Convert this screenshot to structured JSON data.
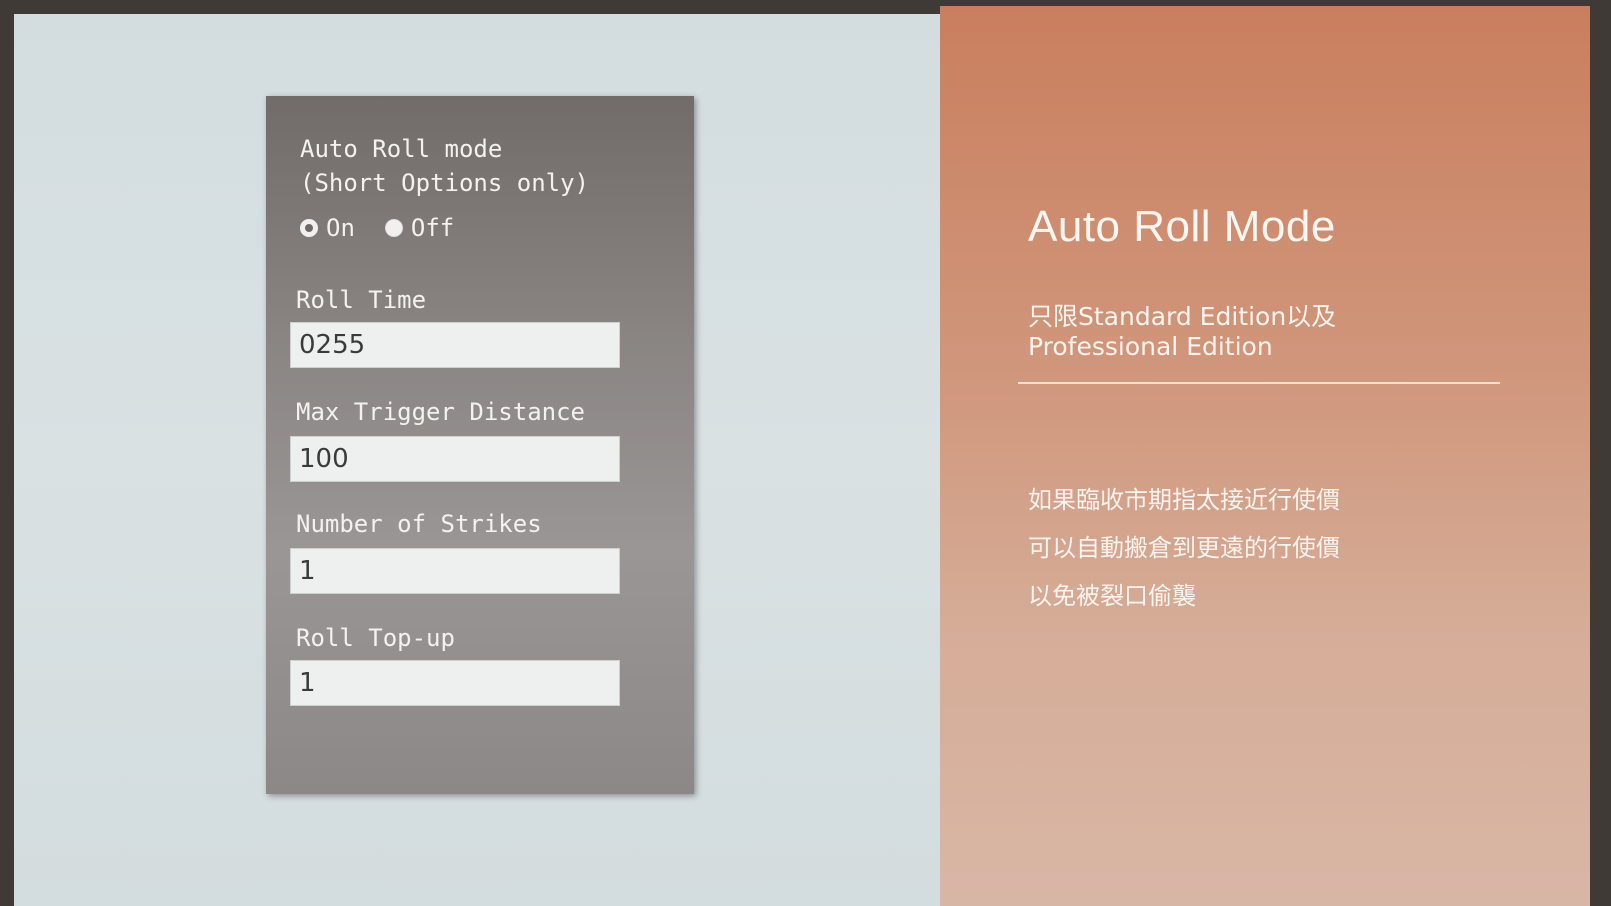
{
  "settings": {
    "mode_title": "Auto Roll mode\n(Short Options only)",
    "radio_on_label": "On",
    "radio_off_label": "Off",
    "selected": "On",
    "fields": [
      {
        "label": "Roll Time",
        "value": "0255"
      },
      {
        "label": "Max Trigger Distance",
        "value": "100"
      },
      {
        "label": "Number of Strikes",
        "value": "1"
      },
      {
        "label": "Roll Top-up",
        "value": "1"
      }
    ]
  },
  "info": {
    "title": "Auto Roll Mode",
    "subtitle": "只限Standard Edition以及\nProfessional Edition",
    "body_lines": [
      "如果臨收市期指太接近行使價",
      "可以自動搬倉到更遠的行使價",
      "以免被裂口偷襲"
    ]
  },
  "colors": {
    "card_background": "#8a8583",
    "info_background": "#d0967b",
    "page_background": "#d9e1e3"
  }
}
